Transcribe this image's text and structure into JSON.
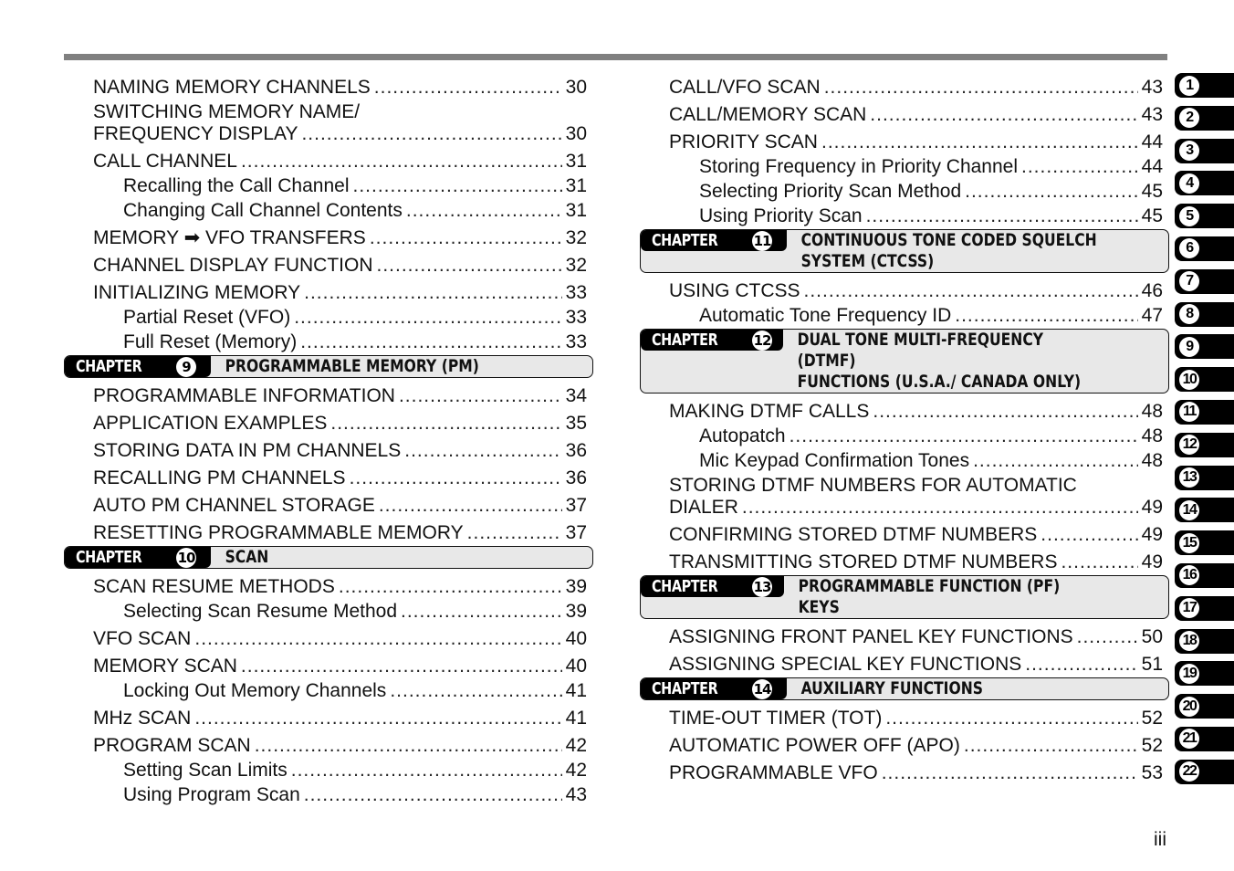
{
  "page_number": "iii",
  "left_column": [
    {
      "type": "entry",
      "level": 1,
      "text": "NAMING MEMORY CHANNELS",
      "page": "30"
    },
    {
      "type": "multi",
      "level": 1,
      "line1": "SWITCHING MEMORY NAME/",
      "text": "FREQUENCY DISPLAY",
      "page": "30"
    },
    {
      "type": "entry",
      "level": 1,
      "text": "CALL CHANNEL",
      "page": "31"
    },
    {
      "type": "entry",
      "level": 2,
      "text": "Recalling the Call Channel",
      "page": "31"
    },
    {
      "type": "entry",
      "level": 2,
      "text": "Changing Call Channel Contents",
      "page": "31"
    },
    {
      "type": "entry",
      "level": 1,
      "text": "MEMORY ➡ VFO TRANSFERS",
      "page": "32"
    },
    {
      "type": "entry",
      "level": 1,
      "text": "CHANNEL DISPLAY FUNCTION",
      "page": "32"
    },
    {
      "type": "entry",
      "level": 1,
      "text": "INITIALIZING MEMORY",
      "page": "33"
    },
    {
      "type": "entry",
      "level": 2,
      "text": "Partial Reset (VFO)",
      "page": "33"
    },
    {
      "type": "entry",
      "level": 2,
      "text": "Full Reset (Memory)",
      "page": "33"
    },
    {
      "type": "chapter",
      "label": "CHAPTER",
      "number": "9",
      "title": "PROGRAMMABLE MEMORY (PM)"
    },
    {
      "type": "entry",
      "level": 1,
      "text": "PROGRAMMABLE INFORMATION",
      "page": "34"
    },
    {
      "type": "entry",
      "level": 1,
      "text": "APPLICATION EXAMPLES",
      "page": "35"
    },
    {
      "type": "entry",
      "level": 1,
      "text": "STORING DATA IN PM CHANNELS",
      "page": "36"
    },
    {
      "type": "entry",
      "level": 1,
      "text": "RECALLING PM CHANNELS",
      "page": "36"
    },
    {
      "type": "entry",
      "level": 1,
      "text": "AUTO PM CHANNEL STORAGE",
      "page": "37"
    },
    {
      "type": "entry",
      "level": 1,
      "text": "RESETTING PROGRAMMABLE MEMORY",
      "page": "37"
    },
    {
      "type": "chapter",
      "label": "CHAPTER",
      "number": "10",
      "title": "SCAN"
    },
    {
      "type": "entry",
      "level": 1,
      "text": "SCAN RESUME METHODS",
      "page": "39"
    },
    {
      "type": "entry",
      "level": 2,
      "text": "Selecting Scan Resume Method",
      "page": "39"
    },
    {
      "type": "entry",
      "level": 1,
      "text": "VFO SCAN",
      "page": "40"
    },
    {
      "type": "entry",
      "level": 1,
      "text": "MEMORY SCAN",
      "page": "40"
    },
    {
      "type": "entry",
      "level": 2,
      "text": "Locking Out Memory Channels",
      "page": "41"
    },
    {
      "type": "entry",
      "level": 1,
      "text": "MHz SCAN",
      "page": "41"
    },
    {
      "type": "entry",
      "level": 1,
      "text": "PROGRAM SCAN",
      "page": "42"
    },
    {
      "type": "entry",
      "level": 2,
      "text": "Setting Scan Limits",
      "page": "42"
    },
    {
      "type": "entry",
      "level": 2,
      "text": "Using Program Scan",
      "page": "43"
    }
  ],
  "right_column": [
    {
      "type": "entry",
      "level": 1,
      "text": "CALL/VFO SCAN",
      "page": "43"
    },
    {
      "type": "entry",
      "level": 1,
      "text": "CALL/MEMORY SCAN",
      "page": "43"
    },
    {
      "type": "entry",
      "level": 1,
      "text": "PRIORITY SCAN",
      "page": "44"
    },
    {
      "type": "entry",
      "level": 2,
      "text": "Storing Frequency in Priority Channel",
      "page": "44"
    },
    {
      "type": "entry",
      "level": 2,
      "text": "Selecting Priority Scan Method",
      "page": "45"
    },
    {
      "type": "entry",
      "level": 2,
      "text": "Using Priority Scan",
      "page": "45"
    },
    {
      "type": "chapter",
      "label": "CHAPTER",
      "number": "11",
      "title": "CONTINUOUS TONE CODED SQUELCH\nSYSTEM (CTCSS)"
    },
    {
      "type": "entry",
      "level": 1,
      "text": "USING CTCSS",
      "page": "46"
    },
    {
      "type": "entry",
      "level": 2,
      "text": "Automatic Tone Frequency ID",
      "page": "47"
    },
    {
      "type": "chapter",
      "label": "CHAPTER",
      "number": "12",
      "title": "DUAL TONE MULTI-FREQUENCY (DTMF)\nFUNCTIONS (U.S.A./ CANADA ONLY)"
    },
    {
      "type": "entry",
      "level": 1,
      "text": "MAKING DTMF CALLS",
      "page": "48"
    },
    {
      "type": "entry",
      "level": 2,
      "text": "Autopatch",
      "page": "48"
    },
    {
      "type": "entry",
      "level": 2,
      "text": "Mic Keypad Confirmation Tones",
      "page": "48"
    },
    {
      "type": "multi",
      "level": 1,
      "line1": "STORING DTMF NUMBERS FOR AUTOMATIC",
      "text": "DIALER",
      "page": "49"
    },
    {
      "type": "entry",
      "level": 1,
      "text": "CONFIRMING STORED DTMF NUMBERS",
      "page": "49"
    },
    {
      "type": "entry",
      "level": 1,
      "text": "TRANSMITTING STORED DTMF NUMBERS",
      "page": "49"
    },
    {
      "type": "chapter",
      "label": "CHAPTER",
      "number": "13",
      "title": "PROGRAMMABLE FUNCTION (PF) KEYS"
    },
    {
      "type": "entry",
      "level": 1,
      "text": "ASSIGNING FRONT PANEL KEY FUNCTIONS",
      "page": "50"
    },
    {
      "type": "entry",
      "level": 1,
      "text": "ASSIGNING SPECIAL KEY FUNCTIONS",
      "page": "51"
    },
    {
      "type": "chapter",
      "label": "CHAPTER",
      "number": "14",
      "title": "AUXILIARY FUNCTIONS"
    },
    {
      "type": "entry",
      "level": 1,
      "text": "TIME-OUT TIMER (TOT)",
      "page": "52"
    },
    {
      "type": "entry",
      "level": 1,
      "text": "AUTOMATIC POWER OFF (APO)",
      "page": "52"
    },
    {
      "type": "entry",
      "level": 1,
      "text": "PROGRAMMABLE VFO",
      "page": "53"
    }
  ],
  "chapter_tabs": [
    "1",
    "2",
    "3",
    "4",
    "5",
    "6",
    "7",
    "8",
    "9",
    "10",
    "11",
    "12",
    "13",
    "14",
    "15",
    "16",
    "17",
    "18",
    "19",
    "20",
    "21",
    "22"
  ],
  "colors": {
    "rule": "#808080",
    "chapter_bar": "#e8e8e8",
    "tab": "#000000"
  }
}
